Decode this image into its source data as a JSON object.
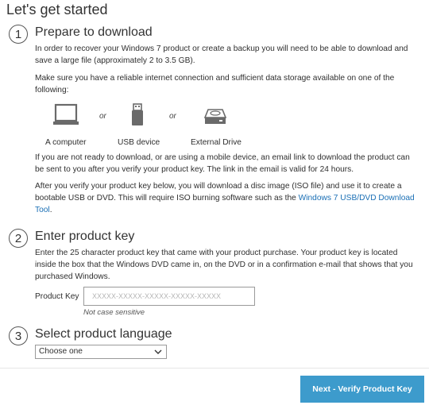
{
  "page": {
    "title": "Let's get started"
  },
  "step1": {
    "number": "1",
    "title": "Prepare to download",
    "para1": "In order to recover your Windows 7 product or create a backup you will need to be able to download and save a large file (approximately 2 to 3.5 GB).",
    "para2": "Make sure you have a reliable internet connection and sufficient data storage available on one of the following:",
    "devices": [
      {
        "label": "A computer",
        "icon": "laptop-icon"
      },
      {
        "label": "USB device",
        "icon": "usb-drive-icon"
      },
      {
        "label": "External Drive",
        "icon": "external-drive-icon"
      }
    ],
    "or_text": "or",
    "para3": "If you are not ready to download, or are using a mobile device, an email link to download the product can be sent to you after you verify your product key. The link in the email is valid for 24 hours.",
    "para4_prefix": "After you verify your product key below, you will download a disc image (ISO file) and use it to create a bootable USB or DVD.  This will require ISO burning software such as the ",
    "para4_link": "Windows 7 USB/DVD Download Tool",
    "para4_suffix": "."
  },
  "step2": {
    "number": "2",
    "title": "Enter product key",
    "description": "Enter the 25 character product key that came with your product purchase.  Your product key is located inside the box that the Windows DVD came in, on the DVD or in a confirmation e-mail that shows that you purchased Windows.",
    "field_label": "Product Key",
    "placeholder": "XXXXX-XXXXX-XXXXX-XXXXX-XXXXX",
    "hint": "Not case sensitive"
  },
  "step3": {
    "number": "3",
    "title": "Select product language",
    "selected": "Choose one"
  },
  "actions": {
    "next_label": "Next - Verify Product Key"
  }
}
